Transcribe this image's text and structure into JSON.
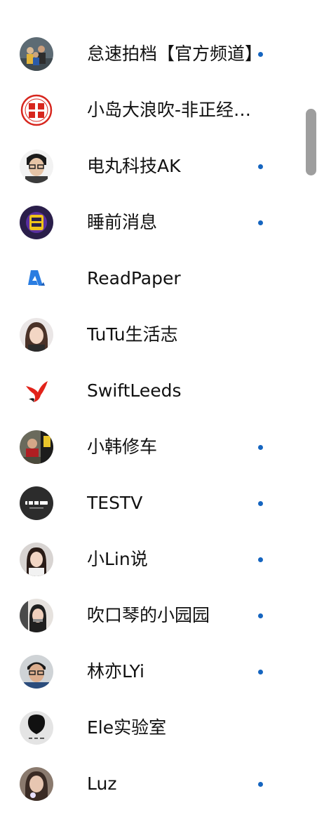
{
  "subscriptions": [
    {
      "name": "怠速拍档【官方频道】",
      "icon": "avatar-photo-group",
      "has_new": true
    },
    {
      "name": "小岛大浪吹-非正经科技",
      "icon": "avatar-red-seal-logo",
      "has_new": false
    },
    {
      "name": "电丸科技AK",
      "icon": "avatar-person-glasses",
      "has_new": true
    },
    {
      "name": "睡前消息",
      "icon": "avatar-purple-badge",
      "has_new": true
    },
    {
      "name": "ReadPaper",
      "icon": "avatar-blue-r-logo",
      "has_new": false
    },
    {
      "name": "TuTu生活志",
      "icon": "avatar-woman-portrait",
      "has_new": false
    },
    {
      "name": "SwiftLeeds",
      "icon": "avatar-red-swift-bird-logo",
      "has_new": false
    },
    {
      "name": "小韩修车",
      "icon": "avatar-person-workshop",
      "has_new": true
    },
    {
      "name": "TESTV",
      "icon": "avatar-testv-logo",
      "has_new": true
    },
    {
      "name": "小Lin说",
      "icon": "avatar-woman-portrait",
      "has_new": true
    },
    {
      "name": "吹口琴的小园园",
      "icon": "avatar-person-harmonica",
      "has_new": true
    },
    {
      "name": "林亦LYi",
      "icon": "avatar-man-glasses",
      "has_new": true
    },
    {
      "name": "Ele实验室",
      "icon": "avatar-ele-alien-logo",
      "has_new": false
    },
    {
      "name": "Luz",
      "icon": "avatar-portrait-dark",
      "has_new": true
    }
  ],
  "colors": {
    "new_dot": "#1565c0",
    "text": "#111111",
    "scrollbar": "#9e9e9e"
  }
}
